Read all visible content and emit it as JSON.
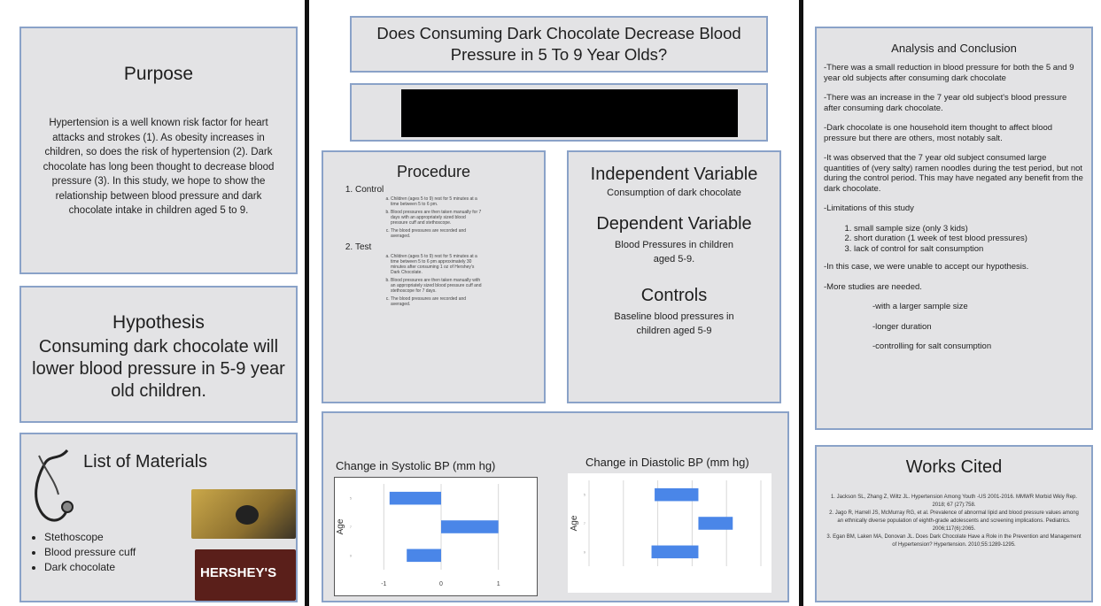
{
  "purpose": {
    "title": "Purpose",
    "body": "Hypertension is a well known risk factor for heart attacks and strokes (1). As obesity increases in children, so does the risk of hypertension (2). Dark chocolate has long been thought to decrease blood pressure (3). In this study, we hope to show the relationship between blood pressure and dark chocolate intake in children aged 5 to 9."
  },
  "hypothesis": {
    "title": "Hypothesis",
    "body": "Consuming dark chocolate will lower blood pressure in 5-9 year old children."
  },
  "materials": {
    "title": "List of Materials",
    "items": [
      "Stethoscope",
      "Blood pressure cuff",
      "Dark chocolate"
    ],
    "wrapper_text": "HERSHEY'S"
  },
  "header": {
    "title": "Does Consuming Dark Chocolate Decrease Blood Pressure in 5 To 9 Year Olds?"
  },
  "procedure": {
    "title": "Procedure",
    "steps": [
      {
        "label": "Control",
        "substeps": [
          "Children (ages 5 to 9) rest for 5 minutes at a time between 5 to 6 pm.",
          "Blood pressures are then taken manually for 7 days with an appropriately sized blood pressure cuff and stethoscope.",
          "The blood pressures are recorded and averaged."
        ]
      },
      {
        "label": "Test",
        "substeps": [
          "Children (ages 5 to 9) rest for 5 minutes at a time between 5 to 6 pm approximately 30 minutes after consuming 1 oz of Hershey's Dark Chocolate.",
          "Blood pressures are then taken manually with an appropriately sized blood pressure cuff and stethoscope for 7 days.",
          "The blood pressures are recorded and averaged."
        ]
      }
    ]
  },
  "variables": {
    "independent_title": "Independent Variable",
    "independent_body": "Consumption of dark chocolate",
    "dependent_title": "Dependent Variable",
    "dependent_body": "Blood Pressures in children aged 5-9.",
    "controls_title": "Controls",
    "controls_body": "Baseline blood pressures in children aged 5-9"
  },
  "analysis": {
    "title": "Analysis and Conclusion",
    "paragraphs_top": [
      "-There was a small reduction in blood pressure for both the 5 and 9 year old subjects after consuming dark chocolate",
      "-There was an increase in the 7 year old subject's blood pressure after consuming dark chocolate.",
      "-Dark chocolate is one household item thought to affect blood pressure but there are others, most notably salt.",
      "-It was observed that the 7 year old subject consumed large quantities of (very salty) ramen noodles during the test period, but not during the control period. This may have negated any benefit from the dark chocolate.",
      "-Limitations of this study"
    ],
    "limitations": [
      "small sample size (only 3 kids)",
      "short duration (1 week of test blood pressures)",
      "lack of control for salt consumption"
    ],
    "paragraphs_bottom": [
      "-In this case, we were unable to accept our hypothesis.",
      "-More studies are needed."
    ],
    "needs": [
      "-with a larger sample size",
      "-longer duration",
      "-controlling for salt consumption"
    ]
  },
  "works_cited": {
    "title": "Works Cited",
    "refs": [
      "1. Jackson SL, Zhang Z, Wiltz JL. Hypertension Among Youth -US 2001-2016. MMWR Morbid Wkly Rep. 2018; 67 (27):758.",
      "2. Jago R, Harrell JS, McMurray RG, et al. Prevalence of abnormal lipid and blood pressure values among an ethnically diverse population of eighth-grade adolescents and screening implications. Pediatrics. 2006;117(6):2065.",
      "3. Egan BM, Laken MA, Donovan JL. Does Dark Chocolate Have a Role in the Prevention and Management of Hypertension? Hypertension. 2010;55:1289-1295."
    ]
  },
  "colors": {
    "bar": "#4a86e8",
    "border": "#8aa2c8",
    "divider": "#111111"
  },
  "chart_data": [
    {
      "type": "bar",
      "orientation": "horizontal",
      "title": "Change in Systolic BP (mm hg)",
      "ylabel": "Age",
      "xlabel": "",
      "categories": [
        "5",
        "7",
        "9"
      ],
      "values": [
        -0.9,
        1.0,
        -0.6
      ],
      "xlim": [
        -1.5,
        1.5
      ],
      "xticks": [
        "-1",
        "0",
        "1"
      ],
      "grid": true
    },
    {
      "type": "bar",
      "orientation": "horizontal",
      "title": "Change in Diastolic BP (mm hg)",
      "ylabel": "Age",
      "xlabel": "",
      "categories": [
        "5",
        "7",
        "9"
      ],
      "values": [
        -1.4,
        1.1,
        -1.5
      ],
      "xlim": [
        -3.5,
        2
      ],
      "xticks": [],
      "grid": true
    }
  ]
}
